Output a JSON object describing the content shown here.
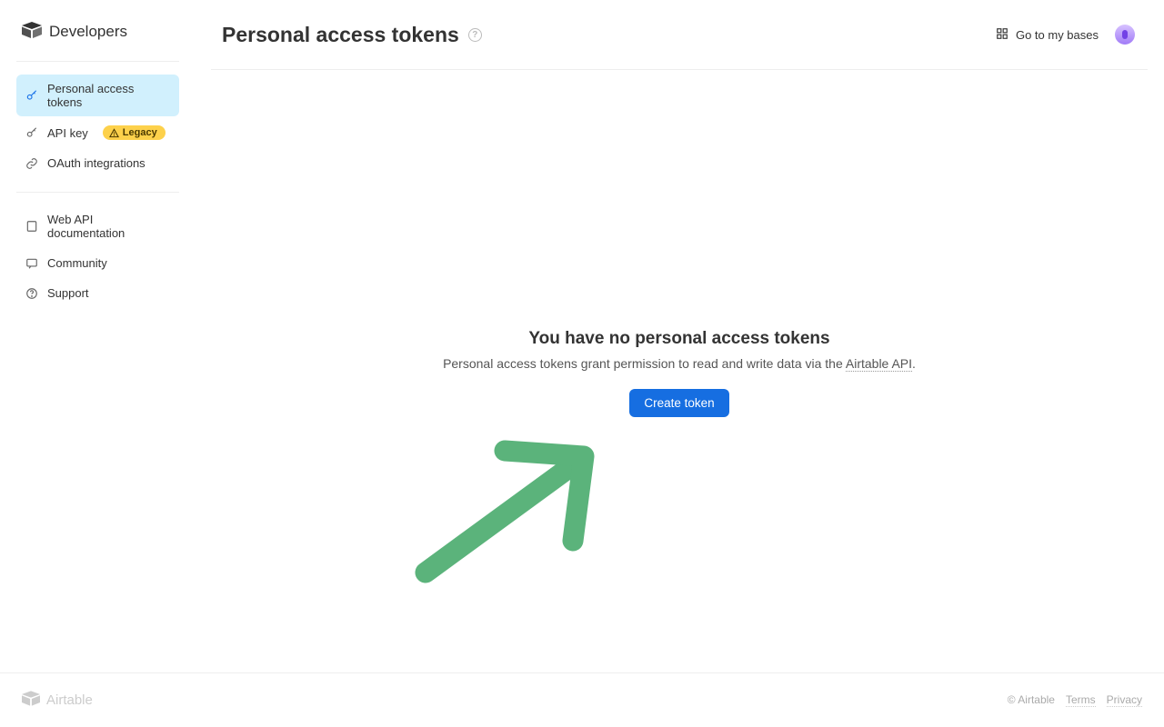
{
  "brand": "Developers",
  "sidebar": {
    "group1": [
      {
        "key": "pats",
        "label": "Personal access tokens",
        "active": true
      },
      {
        "key": "apikey",
        "label": "API key",
        "legacy_badge": "Legacy"
      },
      {
        "key": "oauth",
        "label": "OAuth integrations"
      }
    ],
    "group2": [
      {
        "key": "docs",
        "label": "Web API documentation"
      },
      {
        "key": "comm",
        "label": "Community"
      },
      {
        "key": "support",
        "label": "Support"
      }
    ]
  },
  "header": {
    "title": "Personal access tokens",
    "go_to_bases": "Go to my bases"
  },
  "empty_state": {
    "heading": "You have no personal access tokens",
    "desc_prefix": "Personal access tokens grant permission to read and write data via the ",
    "desc_link": "Airtable API",
    "desc_suffix": ".",
    "cta": "Create token"
  },
  "footer": {
    "brand": "Airtable",
    "copyright": "© Airtable",
    "terms": "Terms",
    "privacy": "Privacy"
  }
}
